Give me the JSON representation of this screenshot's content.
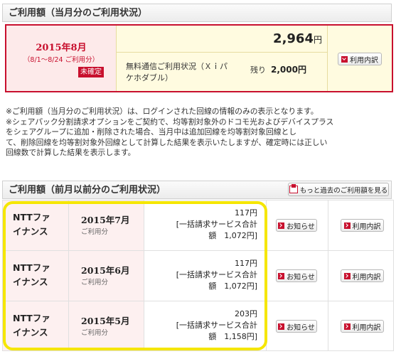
{
  "current": {
    "header": "ご利用額（当月分のご利用状況）",
    "period": "2015年8月",
    "period_range": "（8/1〜8/24 ご利用分）",
    "status_badge": "未確定",
    "amount": "2,964",
    "yen": "円",
    "free_label": "無料通信ご利用状況（Ｘｉパケホダブル）",
    "remaining_label": "残り",
    "remaining_amount": "2,000円",
    "detail_button": "利用内訳"
  },
  "notes": [
    "※ご利用額（当月分のご利用状況）は、ログインされた回線の情報のみの表示となります。",
    "※シェアパック分割請求オプションをご契約で、均等割対象外のドコモ光およびデバイスプラス",
    "て、削除回線を均等割対象外回線として計算した結果を表示いたしますが、確定時には正しい",
    "回線数で計算した結果を表示します。"
  ],
  "notes_line2b": "をシェアグループに追加・削除された場合、当月中は追加回線を均等割対象回線とし",
  "previous": {
    "header": "ご利用額（前月以前分のご利用状況）",
    "more_button": "もっと過去のご利用額を見る",
    "sub_label": "ご利用分",
    "notice_button": "お知らせ",
    "detail_button": "利用内訳",
    "rows": [
      {
        "company_1": "NTTファ",
        "company_2": "イナンス",
        "month": "2015年7月",
        "amount": "117円",
        "bulk_1": "[一括請求サービス合計",
        "bulk_2": "額　1,072円]"
      },
      {
        "company_1": "NTTファ",
        "company_2": "イナンス",
        "month": "2015年6月",
        "amount": "117円",
        "bulk_1": "[一括請求サービス合計",
        "bulk_2": "額　1,072円]"
      },
      {
        "company_1": "NTTファ",
        "company_2": "イナンス",
        "month": "2015年5月",
        "amount": "203円",
        "bulk_1": "[一括請求サービス合計",
        "bulk_2": "額　1,158円]"
      }
    ]
  },
  "colors": {
    "accent_red": "#c8102e",
    "highlight_yellow": "#f5e600",
    "pink_bg": "#fdf0f0",
    "cream_bg": "#fffbe0"
  }
}
